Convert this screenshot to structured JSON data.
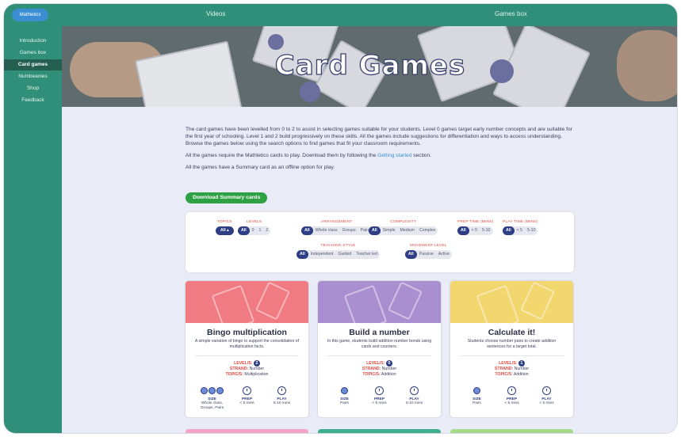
{
  "brand": {
    "logo_text": "Mathletics"
  },
  "topnav": {
    "videos": "Videos",
    "games_box": "Games box"
  },
  "sidebar": {
    "items": [
      {
        "label": "Introduction",
        "active": false
      },
      {
        "label": "Games box",
        "active": false
      },
      {
        "label": "Card games",
        "active": true
      },
      {
        "label": "Numbeanies",
        "active": false
      },
      {
        "label": "Shop",
        "active": false
      },
      {
        "label": "Feedback",
        "active": false
      }
    ]
  },
  "hero": {
    "title": "Card Games"
  },
  "intro": {
    "p1": "The card games have been levelled from 0 to 2 to assist in selecting games suitable for your students. Level 0 games target early number concepts and are suitable for the first year of schooling. Level 1 and 2 build progressively on these skills. All the games include suggestions for differentiation and ways to access understanding. Browse the games below using the search options to find games that fit your classroom requirements.",
    "p2_before": "All the games require the Mathletics cards to play. Download them by following the ",
    "p2_link": "Getting started",
    "p2_after": " section.",
    "p3": "All the games have a Summary card as an offline option for play."
  },
  "download_button": "Download Summary cards",
  "filters": {
    "topics": {
      "label": "TOPICS",
      "value": "All ▴"
    },
    "levels": {
      "label": "LEVELS",
      "options": [
        "All",
        "0",
        "1",
        "2"
      ]
    },
    "arrangement": {
      "label": "ARRANGEMENT",
      "options": [
        "All",
        "Whole class",
        "Groups",
        "Pairs"
      ]
    },
    "complexity": {
      "label": "COMPLEXITY",
      "options": [
        "All",
        "Simple",
        "Medium",
        "Complex"
      ]
    },
    "prep_time": {
      "label": "PREP TIME (MINS)",
      "options": [
        "All",
        "< 5",
        "5-10"
      ]
    },
    "play_time": {
      "label": "PLAY TIME (MINS)",
      "options": [
        "All",
        "< 5",
        "5-10"
      ]
    },
    "teaching_style": {
      "label": "TEACHING STYLE",
      "options": [
        "All",
        "Independent",
        "Guided",
        "Teacher led"
      ]
    },
    "movement_level": {
      "label": "MOVEMENT LEVEL",
      "options": [
        "All",
        "Passive",
        "Active"
      ]
    }
  },
  "labels": {
    "level": "LEVEL/S:",
    "strand": "STRAND:",
    "topic": "TOPIC/S:",
    "size": "SIZE",
    "prep": "PREP",
    "play": "PLAY"
  },
  "cards": [
    {
      "title": "Bingo multiplication",
      "description": "A simple variation of bingo to support the consolidation of multiplication facts.",
      "level": "2",
      "strand": "Number",
      "topic": "Multiplication",
      "size": "Whole class, Groups, Pairs",
      "prep": "< 5 mins",
      "play": "5-10 mins",
      "color": "#f17b83"
    },
    {
      "title": "Build a number",
      "description": "In this game, students build addition number bonds using cards and counters.",
      "level": "0",
      "strand": "Number",
      "topic": "Addition",
      "size": "Pairs",
      "prep": "< 5 mins",
      "play": "5-10 mins",
      "color": "#a98fcf"
    },
    {
      "title": "Calculate it!",
      "description": "Students choose number pairs to create addition sentences for a target total.",
      "level": "1",
      "strand": "Number",
      "topic": "Addition",
      "size": "Pairs",
      "prep": "< 5 mins",
      "play": "< 5 mins",
      "color": "#f2d66e"
    }
  ],
  "stub_colors": [
    "#f2a6c3",
    "#3fae8c",
    "#a7d98a"
  ]
}
